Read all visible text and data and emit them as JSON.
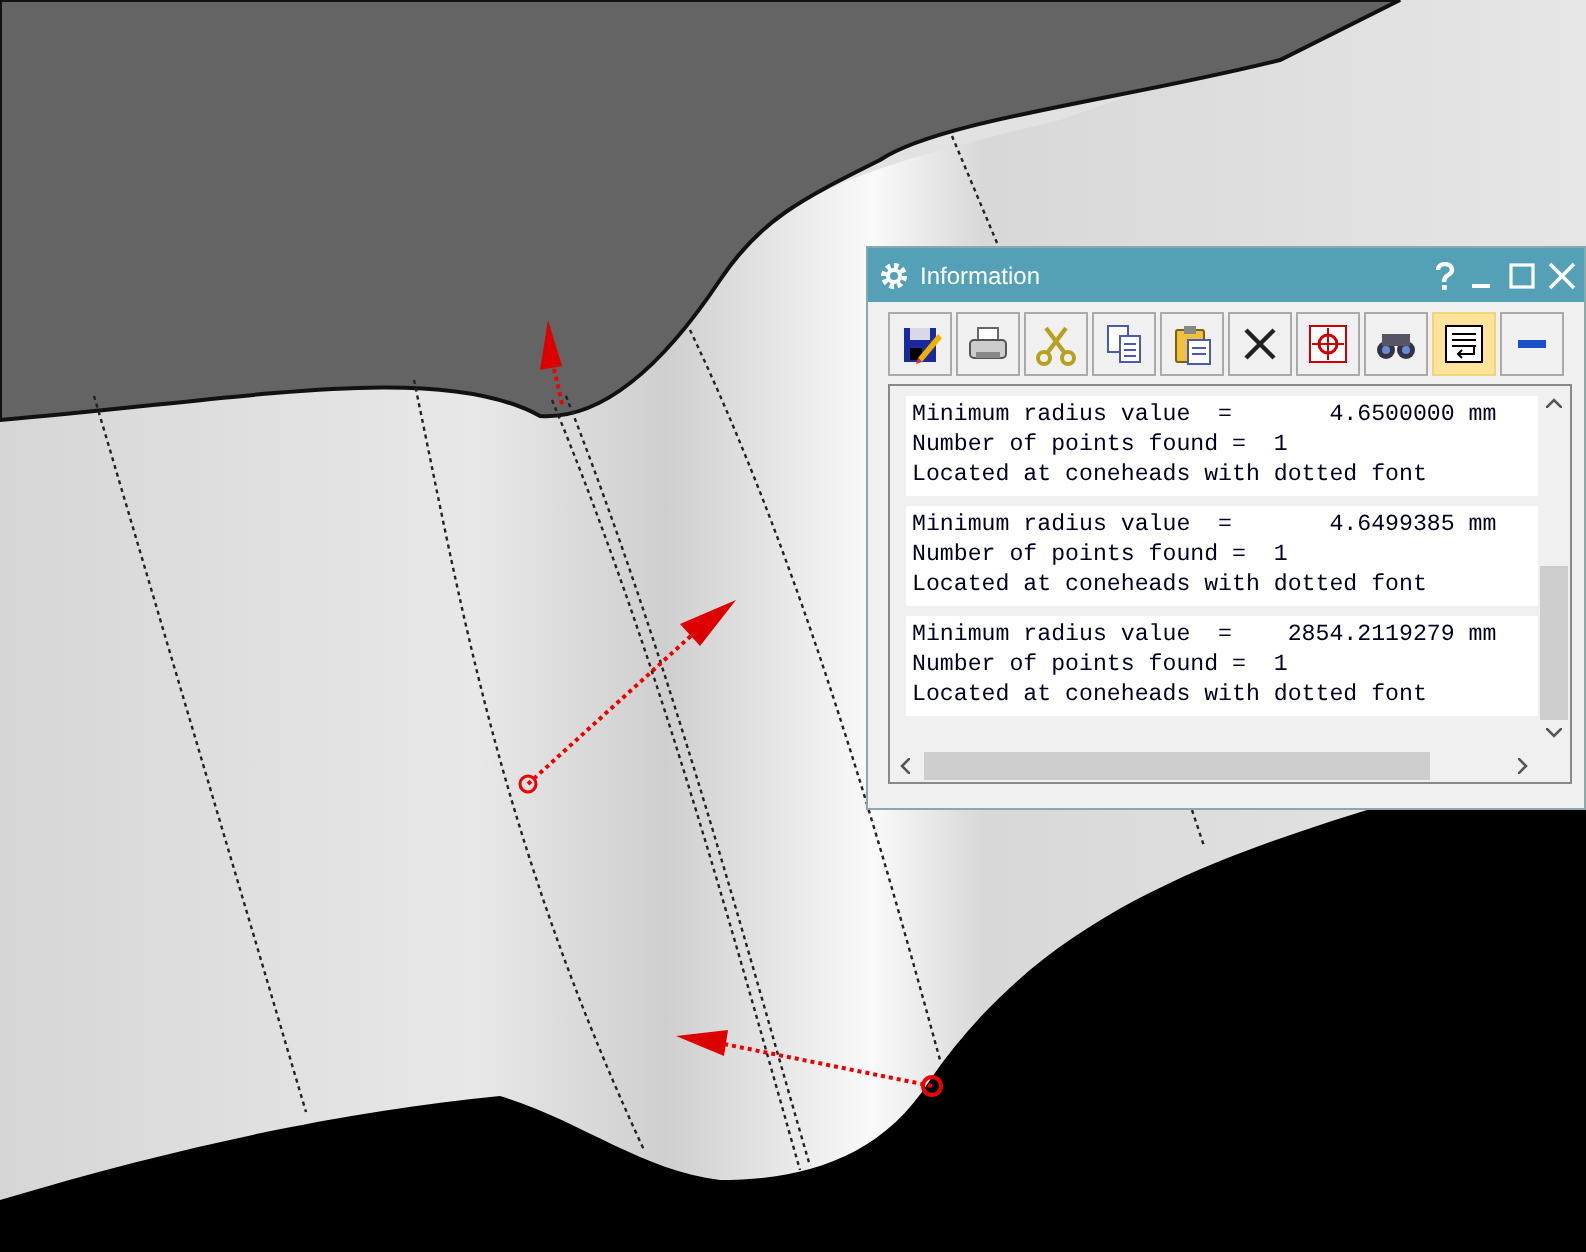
{
  "window": {
    "title": "Information"
  },
  "toolbar": [
    {
      "kind": "save",
      "on": false
    },
    {
      "kind": "print",
      "on": false
    },
    {
      "kind": "cut",
      "on": false
    },
    {
      "kind": "copy",
      "on": false
    },
    {
      "kind": "paste",
      "on": false
    },
    {
      "kind": "delete",
      "on": false
    },
    {
      "kind": "crosshair",
      "on": false
    },
    {
      "kind": "binoculars",
      "on": false
    },
    {
      "kind": "wrap",
      "on": true
    },
    {
      "kind": "minimize",
      "on": false
    }
  ],
  "records": [
    {
      "lines": [
        "Minimum radius value  =       4.6500000 mm",
        "Number of points found =  1",
        "Located at coneheads with dotted font"
      ]
    },
    {
      "lines": [
        "Minimum radius value  =       4.6499385 mm",
        "Number of points found =  1",
        "Located at coneheads with dotted font"
      ]
    },
    {
      "lines": [
        "Minimum radius value  =    2854.2119279 mm",
        "Number of points found =  1",
        "Located at coneheads with dotted font"
      ]
    }
  ]
}
